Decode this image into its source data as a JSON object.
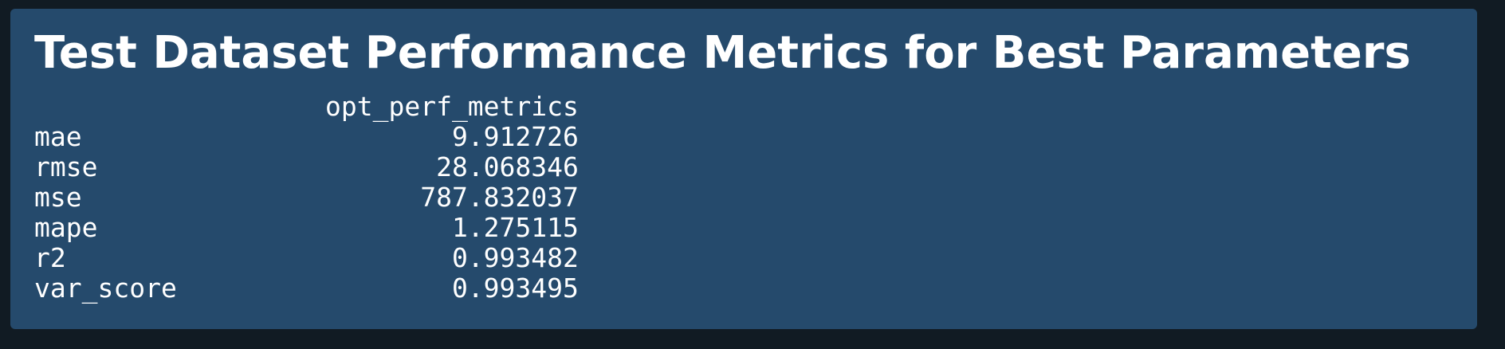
{
  "title": "Test Dataset Performance Metrics for Best Parameters",
  "table": {
    "column_header": "opt_perf_metrics",
    "rows": [
      {
        "label": "mae",
        "value": "9.912726"
      },
      {
        "label": "rmse",
        "value": "28.068346"
      },
      {
        "label": "mse",
        "value": "787.832037"
      },
      {
        "label": "mape",
        "value": "1.275115"
      },
      {
        "label": "r2",
        "value": "0.993482"
      },
      {
        "label": "var_score",
        "value": "0.993495"
      }
    ]
  },
  "colors": {
    "page_background": "#111b23",
    "panel_background": "#254a6c",
    "text": "#ffffff"
  }
}
